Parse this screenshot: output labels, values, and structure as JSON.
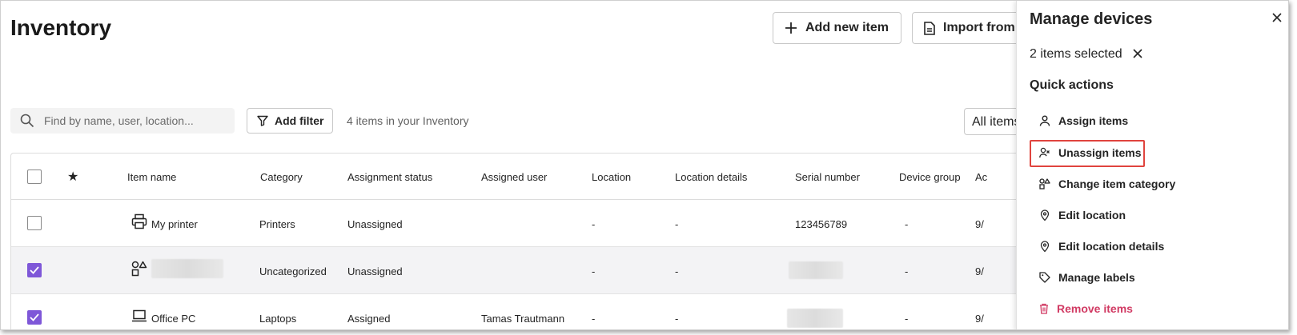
{
  "page": {
    "title": "Inventory"
  },
  "toolbar": {
    "add_label": "Add new item",
    "import_label": "Import from"
  },
  "search": {
    "placeholder": "Find by name, user, location..."
  },
  "filter": {
    "label": "Add filter"
  },
  "items_count": "4 items in your Inventory",
  "view_select": {
    "value": "All items"
  },
  "table": {
    "headers": {
      "star": "★",
      "item_name": "Item name",
      "category": "Category",
      "assignment_status": "Assignment status",
      "assigned_user": "Assigned user",
      "location": "Location",
      "location_details": "Location details",
      "serial_number": "Serial number",
      "device_group": "Device group",
      "added": "Ac"
    },
    "rows": [
      {
        "checked": false,
        "icon": "printer-icon",
        "name": "My printer",
        "category": "Printers",
        "status": "Unassigned",
        "user": "",
        "location": "-",
        "location_details": "-",
        "serial": "123456789",
        "group": "-",
        "added": "9/"
      },
      {
        "checked": true,
        "icon": "shapes-icon",
        "name": "",
        "category": "Uncategorized",
        "status": "Unassigned",
        "user": "",
        "location": "-",
        "location_details": "-",
        "serial": "",
        "group": "-",
        "added": "9/"
      },
      {
        "checked": true,
        "icon": "laptop-icon",
        "name": "Office PC",
        "category": "Laptops",
        "status": "Assigned",
        "user": "Tamas Trautmann",
        "location": "-",
        "location_details": "-",
        "serial": "",
        "group": "-",
        "added": "9/"
      }
    ]
  },
  "panel": {
    "title": "Manage devices",
    "selected_text": "2 items selected",
    "quick_actions_title": "Quick actions",
    "actions": [
      {
        "label": "Assign items",
        "icon": "person-icon"
      },
      {
        "label": "Unassign items",
        "icon": "person-remove-icon"
      },
      {
        "label": "Change item category",
        "icon": "shapes-icon"
      },
      {
        "label": "Edit location",
        "icon": "location-pin-icon"
      },
      {
        "label": "Edit location details",
        "icon": "location-pin-icon"
      },
      {
        "label": "Manage labels",
        "icon": "tag-icon"
      },
      {
        "label": "Remove items",
        "icon": "trash-icon"
      }
    ],
    "danger_color": "#d13a63",
    "highlight_color": "#e0443e"
  },
  "colors": {
    "checkbox_accent": "#7e57d8"
  }
}
